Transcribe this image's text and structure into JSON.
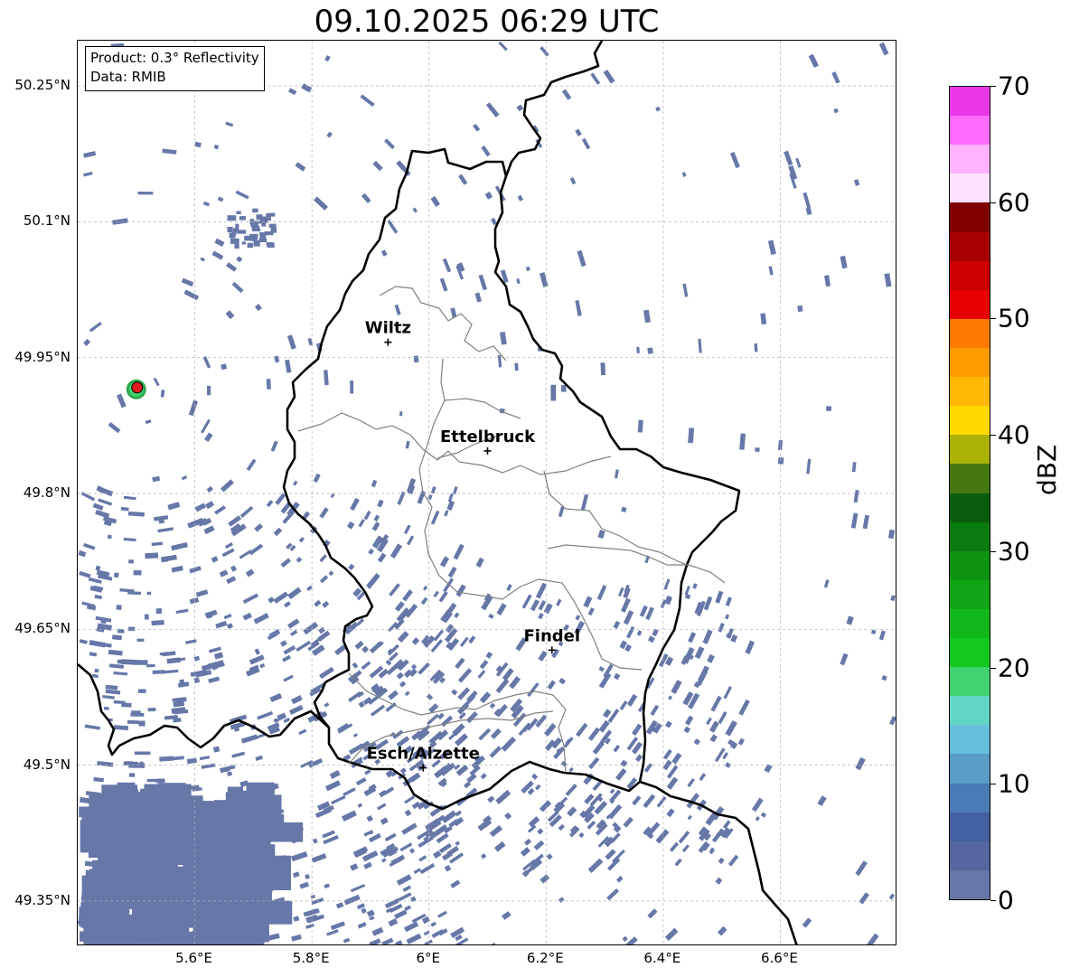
{
  "title": "09.10.2025 06:29 UTC",
  "info": {
    "product": "Product: 0.3° Reflectivity",
    "data_source": "Data: RMIB"
  },
  "map": {
    "lon_range": [
      5.4,
      6.8
    ],
    "lat_range": [
      49.3,
      50.3
    ],
    "lon_ticks": [
      "5.6°E",
      "5.8°E",
      "6°E",
      "6.2°E",
      "6.4°E",
      "6.6°E"
    ],
    "lon_tick_values": [
      5.6,
      5.8,
      6.0,
      6.2,
      6.4,
      6.6
    ],
    "lat_ticks": [
      "50.25°N",
      "50.1°N",
      "49.95°N",
      "49.8°N",
      "49.65°N",
      "49.5°N",
      "49.35°N"
    ],
    "lat_tick_values": [
      50.25,
      50.1,
      49.95,
      49.8,
      49.65,
      49.5,
      49.35
    ],
    "gridlines": true,
    "radar_site": {
      "lon": 5.5,
      "lat": 49.915,
      "color": "#e41a1c"
    },
    "cities": [
      {
        "name": "Wiltz",
        "lon": 5.93,
        "lat": 49.967
      },
      {
        "name": "Ettelbruck",
        "lon": 6.1,
        "lat": 49.847
      },
      {
        "name": "Findel",
        "lon": 6.21,
        "lat": 49.627
      },
      {
        "name": "Esch/Alzette",
        "lon": 5.99,
        "lat": 49.497
      }
    ],
    "precip_color": "#6677a8",
    "seed": 9102025
  },
  "colorbar": {
    "label": "dBZ",
    "min": 0,
    "max": 70,
    "ticks": [
      "0",
      "10",
      "20",
      "30",
      "40",
      "50",
      "60",
      "70"
    ],
    "tick_values": [
      0,
      10,
      20,
      30,
      40,
      50,
      60,
      70
    ],
    "colors": [
      "#6677a8",
      "#5566a0",
      "#4460a0",
      "#4a7bb4",
      "#5a9ec8",
      "#66c0dc",
      "#62d6c6",
      "#40d470",
      "#14c81e",
      "#12b81a",
      "#10a516",
      "#0d9212",
      "#0b7c10",
      "#095e0e",
      "#447810",
      "#aab208",
      "#ffd800",
      "#ffb804",
      "#ff9c00",
      "#ff7a00",
      "#e80000",
      "#cc0000",
      "#a80000",
      "#800000",
      "#ffe2ff",
      "#ffb2ff",
      "#ff6cff",
      "#e838e8"
    ]
  }
}
